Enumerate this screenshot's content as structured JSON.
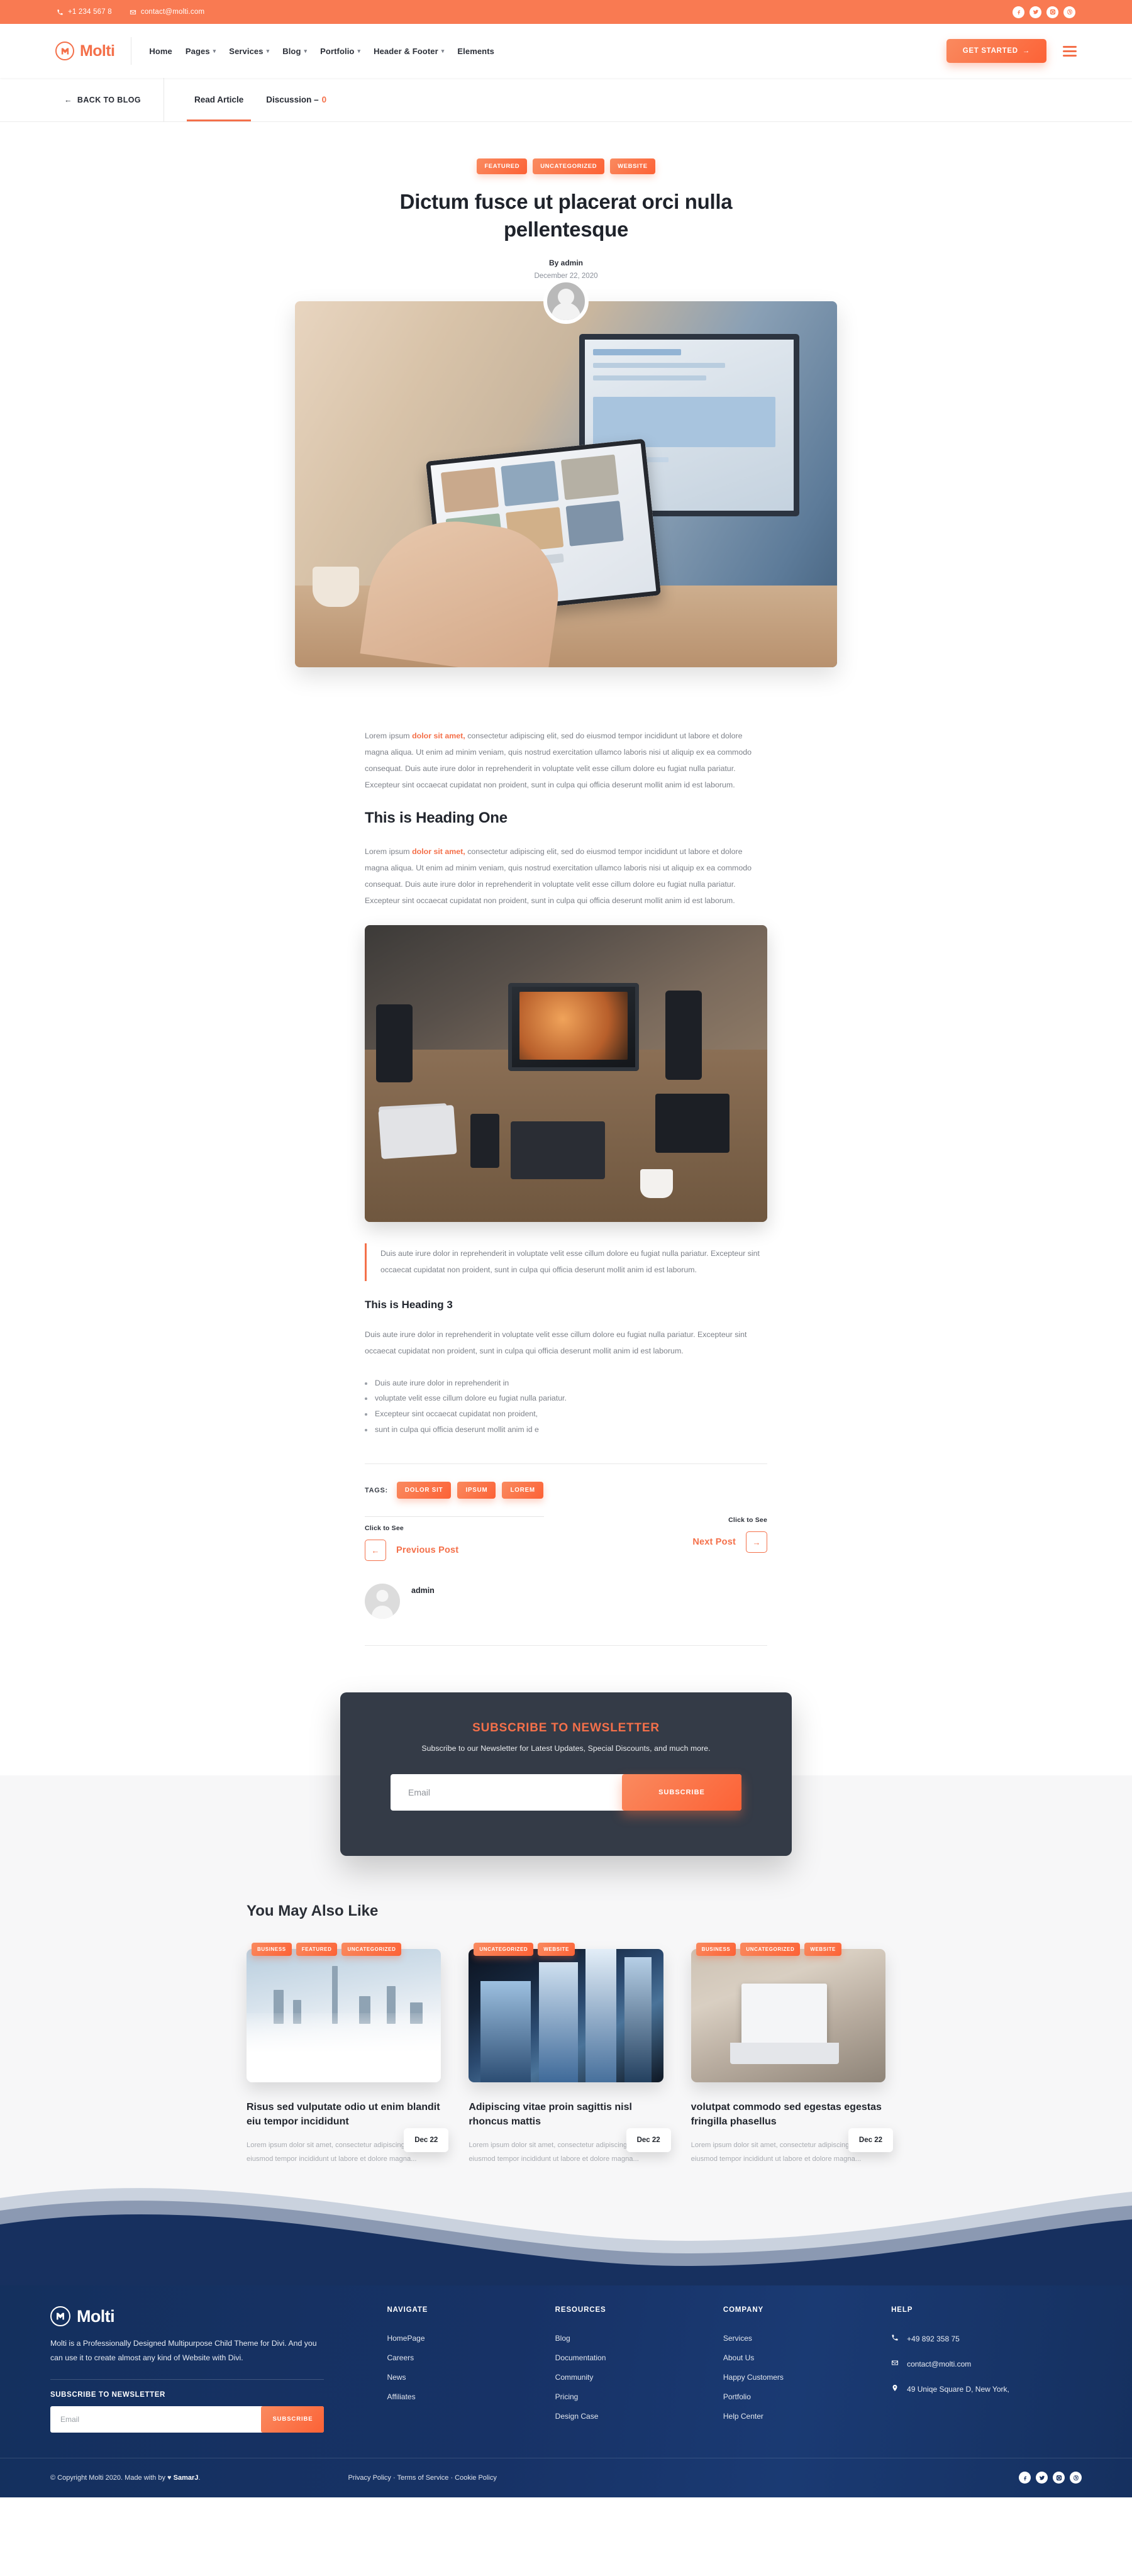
{
  "topbar": {
    "phone": "+1 234 567 8",
    "email": "contact@molti.com",
    "socials": [
      "facebook-icon",
      "twitter-icon",
      "instagram-icon",
      "dribbble-icon"
    ]
  },
  "header": {
    "brand": "Molti",
    "nav": [
      {
        "label": "Home",
        "caret": false
      },
      {
        "label": "Pages",
        "caret": true
      },
      {
        "label": "Services",
        "caret": true
      },
      {
        "label": "Blog",
        "caret": true
      },
      {
        "label": "Portfolio",
        "caret": true
      },
      {
        "label": "Header & Footer",
        "caret": true
      },
      {
        "label": "Elements",
        "caret": false
      }
    ],
    "cta": "GET STARTED",
    "cta_arrow": "→",
    "menu_icon": "hamburger-icon"
  },
  "articlebar": {
    "back": "BACK TO BLOG",
    "back_arrow": "←",
    "tabs": [
      {
        "label": "Read Article",
        "active": true
      },
      {
        "label": "Discussion – ",
        "count": "0",
        "active": false
      }
    ]
  },
  "article": {
    "badges": [
      "FEATURED",
      "UNCATEGORIZED",
      "WEBSITE"
    ],
    "title": "Dictum fusce ut placerat orci nulla pellentesque",
    "byline": "By admin",
    "date": "December 22, 2020",
    "para1_a": "Lorem ipsum ",
    "para1_hl": "dolor sit amet,",
    "para1_b": " consectetur adipiscing elit, sed do eiusmod tempor incididunt ut labore et dolore magna aliqua. Ut enim ad minim veniam, quis nostrud exercitation ullamco laboris nisi ut aliquip ex ea commodo consequat. Duis aute irure dolor in reprehenderit in voluptate velit esse cillum dolore eu fugiat nulla pariatur. Excepteur sint occaecat cupidatat non proident, sunt in culpa qui officia deserunt mollit anim id est laborum.",
    "heading_one": "This is Heading One",
    "para2_a": "Lorem ipsum ",
    "para2_hl": "dolor sit amet,",
    "para2_b": " consectetur adipiscing elit, sed do eiusmod tempor incididunt ut labore et dolore magna aliqua. Ut enim ad minim veniam, quis nostrud exercitation ullamco laboris nisi ut aliquip ex ea commodo consequat. Duis aute irure dolor in reprehenderit in voluptate velit esse cillum dolore eu fugiat nulla pariatur. Excepteur sint occaecat cupidatat non proident, sunt in culpa qui officia deserunt mollit anim id est laborum.",
    "quote": "Duis aute irure dolor in reprehenderit in voluptate velit esse cillum dolore eu fugiat nulla pariatur. Excepteur sint occaecat cupidatat non proident, sunt in culpa qui officia deserunt mollit anim id est laborum.",
    "heading_three": "This is Heading 3",
    "para3": "Duis aute irure dolor in reprehenderit in voluptate velit esse cillum dolore eu fugiat nulla pariatur. Excepteur sint occaecat cupidatat non proident, sunt in culpa qui officia deserunt mollit anim id est laborum.",
    "bullets": [
      "Duis aute irure dolor in reprehenderit in",
      "voluptate velit esse cillum dolore eu fugiat nulla pariatur.",
      "Excepteur sint occaecat cupidatat non proident,",
      "sunt in culpa qui officia deserunt mollit anim id e"
    ],
    "tags_label": "TAGS:",
    "tags": [
      "DOLOR SIT",
      "IPSUM",
      "LOREM"
    ],
    "prev_hint": "Click to See",
    "prev_label": "Previous Post",
    "prev_arrow": "←",
    "next_hint": "Click to See",
    "next_label": "Next Post",
    "next_arrow": "→",
    "author_name": "admin"
  },
  "newsletter": {
    "title": "SUBSCRIBE TO NEWSLETTER",
    "subtitle": "Subscribe to our Newsletter for Latest Updates, Special Discounts, and much more.",
    "placeholder": "Email",
    "button": "SUBSCRIBE"
  },
  "related": {
    "title": "You May Also Like",
    "cards": [
      {
        "cats": [
          "BUSINESS",
          "FEATURED",
          "UNCATEGORIZED"
        ],
        "date": "Dec 22",
        "title": "Risus sed vulputate odio ut enim blandit eiu tempor incididunt",
        "excerpt": "Lorem ipsum dolor sit amet, consectetur adipiscing elit, sed do eiusmod tempor incididunt ut labore et dolore magna..."
      },
      {
        "cats": [
          "UNCATEGORIZED",
          "WEBSITE"
        ],
        "date": "Dec 22",
        "title": "Adipiscing vitae proin sagittis nisl rhoncus mattis",
        "excerpt": "Lorem ipsum dolor sit amet, consectetur adipiscing elit, sed do eiusmod tempor incididunt ut labore et dolore magna..."
      },
      {
        "cats": [
          "BUSINESS",
          "UNCATEGORIZED",
          "WEBSITE"
        ],
        "date": "Dec 22",
        "title": "volutpat commodo sed egestas egestas fringilla phasellus",
        "excerpt": "Lorem ipsum dolor sit amet, consectetur adipiscing elit, sed do eiusmod tempor incididunt ut labore et dolore magna..."
      }
    ]
  },
  "footer": {
    "brand": "Molti",
    "description": "Molti is a Professionally Designed  Multipurpose Child Theme for Divi. And you can use it to create almost any kind of Website with Divi.",
    "subscribe_title": "SUBSCRIBE TO NEWSLETTER",
    "subscribe_placeholder": "Email",
    "subscribe_button": "SUBSCRIBE",
    "columns": [
      {
        "title": "NAVIGATE",
        "links": [
          "HomePage",
          "Careers",
          "News",
          "Affiliates"
        ]
      },
      {
        "title": "RESOURCES",
        "links": [
          "Blog",
          "Documentation",
          "Community",
          "Pricing",
          "Design Case"
        ]
      },
      {
        "title": "COMPANY",
        "links": [
          "Services",
          "About Us",
          "Happy Customers",
          "Portfolio",
          "Help Center"
        ]
      }
    ],
    "help_title": "HELP",
    "help_phone": "+49 892 358 75",
    "help_email": "contact@molti.com",
    "help_address": "49 Uniqe Square D, New York,",
    "copyright_pre": "© Copyright Molti 2020. Made with by ",
    "copyright_heart": "♥",
    "copyright_author": "SamarJ",
    "copyright_post": ".",
    "legal": "Privacy Policy · Terms of Service · Cookie Policy",
    "socials": [
      "facebook-icon",
      "twitter-icon",
      "instagram-icon",
      "dribbble-icon"
    ]
  },
  "colors": {
    "accent": "#f4704a",
    "accent_grad_start": "#fa8a5f",
    "accent_grad_end": "#fc6236",
    "topbar_bg": "#f97a52",
    "footer_bg": "#17305f",
    "newsletter_bg": "#343b47",
    "body_text": "#7d8189",
    "heading": "#22262e"
  }
}
